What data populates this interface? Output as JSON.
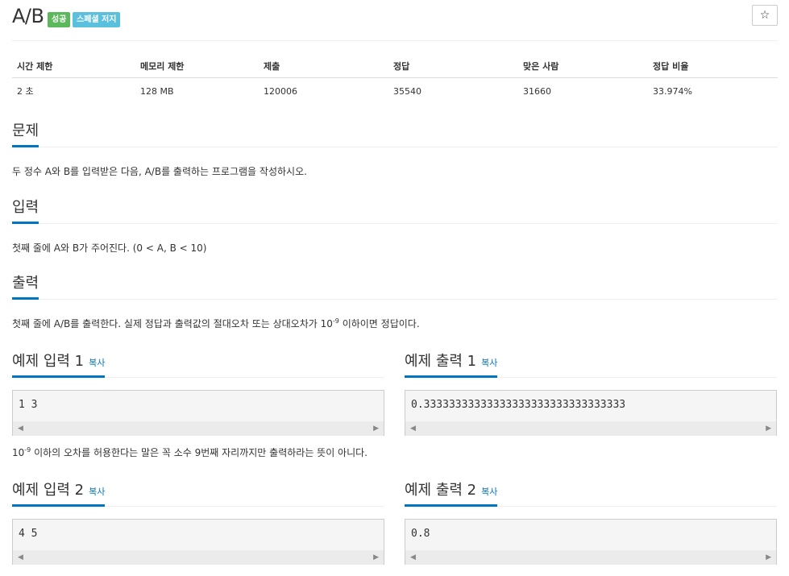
{
  "problem": {
    "title": "A/B",
    "badges": [
      "성공",
      "스페셜 저지"
    ],
    "star_icon": "☆"
  },
  "info": {
    "headers": [
      "시간 제한",
      "메모리 제한",
      "제출",
      "정답",
      "맞은 사람",
      "정답 비율"
    ],
    "values": [
      "2 초",
      "128 MB",
      "120006",
      "35540",
      "31660",
      "33.974%"
    ]
  },
  "sections": {
    "problem_title": "문제",
    "problem_text": "두 정수 A와 B를 입력받은 다음, A/B를 출력하는 프로그램을 작성하시오.",
    "input_title": "입력",
    "input_text": "첫째 줄에 A와 B가 주어진다. (0 < A, B < 10)",
    "output_title": "출력",
    "output_text_pre": "첫째 줄에 A/B를 출력한다. 실제 정답과 출력값의 절대오차 또는 상대오차가 10",
    "output_text_sup": "-9",
    "output_text_post": " 이하이면 정답이다."
  },
  "samples": {
    "copy_label": "복사",
    "input1_title": "예제 입력 1",
    "output1_title": "예제 출력 1",
    "input1": "1 3",
    "output1": "0.33333333333333333333333333333333",
    "note_pre": "10",
    "note_sup": "-9",
    "note_post": " 이하의 오차를 허용한다는 말은 꼭 소수 9번째 자리까지만 출력하라는 뜻이 아니다.",
    "input2_title": "예제 입력 2",
    "output2_title": "예제 출력 2",
    "input2": "4 5",
    "output2": "0.8"
  },
  "scroll": {
    "left_arrow": "◀",
    "right_arrow": "▶"
  },
  "colors": {
    "accent": "#0076c0",
    "success": "#5cb85c",
    "info": "#5bc0de"
  }
}
